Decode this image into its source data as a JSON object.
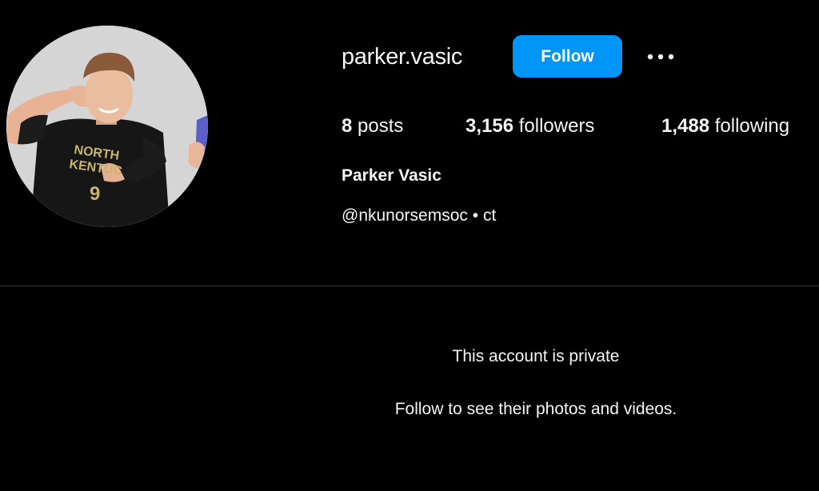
{
  "profile": {
    "username": "parker.vasic",
    "follow_label": "Follow",
    "more_icon": "more-horizontal-icon",
    "posts_count": "8",
    "posts_label": "posts",
    "followers_count": "3,156",
    "followers_label": "followers",
    "following_count": "1,488",
    "following_label": "following",
    "full_name": "Parker Vasic",
    "bio_link": "@nkunorsemsoc",
    "bio_separator": "•",
    "bio_text": "ct",
    "avatar_jersey_text": "NORTHERN KENTUCKY",
    "avatar_jersey_number": "9"
  },
  "private_notice": {
    "title": "This account is private",
    "subtitle": "Follow to see their photos and videos."
  },
  "colors": {
    "background": "#000000",
    "text": "#f5f5f5",
    "follow_button": "#0095f6",
    "divider": "#3a3a3a"
  }
}
